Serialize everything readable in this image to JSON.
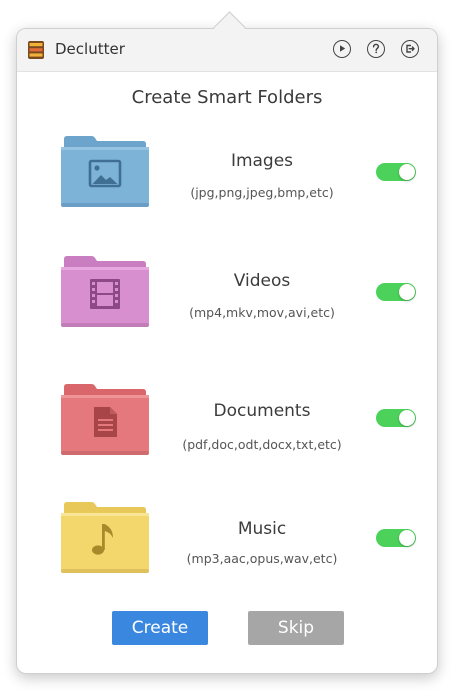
{
  "app": {
    "title": "Declutter"
  },
  "titlebar": {
    "play_icon": "play-icon",
    "help_icon": "help-icon",
    "exit_icon": "exit-icon"
  },
  "main": {
    "heading": "Create Smart Folders",
    "folders": [
      {
        "title": "Images",
        "subtitle": "(jpg,png,jpeg,bmp,etc)",
        "icon": "image-folder-icon",
        "color": "#7eb3d8",
        "enabled": true
      },
      {
        "title": "Videos",
        "subtitle": "(mp4,mkv,mov,avi,etc)",
        "icon": "video-folder-icon",
        "color": "#d88fd0",
        "enabled": true
      },
      {
        "title": "Documents",
        "subtitle": "(pdf,doc,odt,docx,txt,etc)",
        "icon": "document-folder-icon",
        "color": "#e5787c",
        "enabled": true
      },
      {
        "title": "Music",
        "subtitle": "(mp3,aac,opus,wav,etc)",
        "icon": "music-folder-icon",
        "color": "#f3d66c",
        "enabled": true
      }
    ]
  },
  "footer": {
    "create_label": "Create",
    "skip_label": "Skip"
  },
  "colors": {
    "toggle_on": "#4cd15a",
    "create_button": "#3a87df",
    "skip_button": "#a6a6a6"
  }
}
